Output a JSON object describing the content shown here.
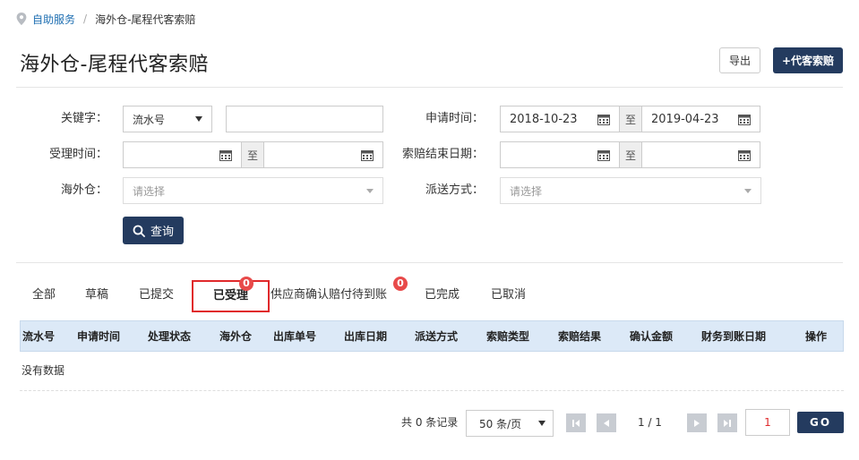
{
  "breadcrumb": {
    "home": "自助服务",
    "separator": "/",
    "current": "海外仓-尾程代客索赔"
  },
  "header": {
    "title": "海外仓-尾程代客索赔",
    "export_label": "导出",
    "claim_label": "+代客索赔"
  },
  "filters": {
    "keyword_label": "关键字：",
    "keyword_type": "流水号",
    "keyword_value": "",
    "apply_time_label": "申请时间：",
    "apply_time_start": "2018-10-23",
    "apply_time_end": "2019-04-23",
    "range_sep": "至",
    "accept_time_label": "受理时间：",
    "accept_time_start": "",
    "accept_time_end": "",
    "claim_end_label": "索赔结束日期：",
    "claim_end_start": "",
    "claim_end_end": "",
    "warehouse_label": "海外仓：",
    "warehouse_placeholder": "请选择",
    "delivery_label": "派送方式：",
    "delivery_placeholder": "请选择",
    "query_label": "查询"
  },
  "tabs": [
    {
      "label": "全部"
    },
    {
      "label": "草稿"
    },
    {
      "label": "已提交"
    },
    {
      "label": "已受理",
      "badge": "0"
    },
    {
      "label": "供应商确认赔付待到账",
      "badge": "0"
    },
    {
      "label": "已完成"
    },
    {
      "label": "已取消"
    }
  ],
  "table": {
    "columns": [
      "流水号",
      "申请时间",
      "处理状态",
      "海外仓",
      "出库单号",
      "出库日期",
      "派送方式",
      "索赔类型",
      "索赔结果",
      "确认金额",
      "财务到账日期",
      "操作"
    ],
    "empty_text": "没有数据"
  },
  "pagination": {
    "total_text": "共 0 条记录",
    "page_size": "50 条/页",
    "page_info": "1 / 1",
    "page_input": "1",
    "go_label": "GO"
  },
  "colors": {
    "primary": "#243b5f",
    "link": "#1f6fb2",
    "highlight": "#e0292b",
    "badge": "#e84a4a",
    "table_header": "#dce9f7"
  }
}
